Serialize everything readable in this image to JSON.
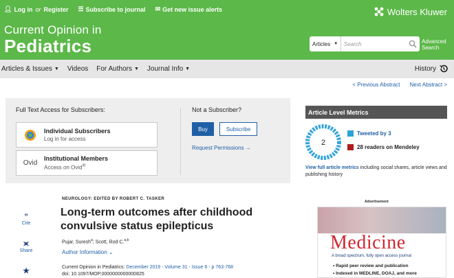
{
  "header": {
    "login_label": "Log in",
    "or_text": "or",
    "register_label": "Register",
    "subscribe_label": "Subscribe to journal",
    "alerts_label": "Get new issue alerts",
    "brand": "Wolters Kluwer",
    "journal_prefix": "Current Opinion in",
    "journal_name": "Pediatrics",
    "search": {
      "scope_selected": "Articles",
      "placeholder": "Search",
      "advanced_line1": "Advanced",
      "advanced_line2": "Search"
    }
  },
  "nav": {
    "items": [
      "Articles & Issues",
      "Videos",
      "For Authors",
      "Journal Info"
    ],
    "history_label": "History"
  },
  "pager": {
    "prev_label": "< Previous Abstract",
    "next_label": "Next Abstract >"
  },
  "access": {
    "title": "Full Text Access for Subscribers:",
    "individual_title": "Individual Subscribers",
    "individual_sub": "Log in for access",
    "institutional_title": "Institutional Members",
    "institutional_sub": "Access on Ovid",
    "ovid_logo": "Ovid",
    "not_subscriber": "Not a Subscriber?",
    "buy_label": "Buy",
    "subscribe_label": "Subscribe",
    "request_permissions": "Request Permissions →"
  },
  "metrics": {
    "title": "Article Level Metrics",
    "altmetric_score": "2",
    "tweeted": "Tweeted by 3",
    "mendeley": "28 readers on Mendeley",
    "view_link": "View full article metrics",
    "view_rest": " including social shares, article views and publishing history",
    "colors": {
      "twitter": "#2aa3d6",
      "mendeley": "#b01c1c",
      "altmetric_ring": "#35a4d9"
    }
  },
  "rail": {
    "cite_label": "Cite",
    "share_label": "Share"
  },
  "article": {
    "section": "NEUROLOGY: EDITED BY ROBERT C. TASKER",
    "title": "Long-term outcomes after childhood convulsive status epilepticus",
    "author1": "Pujar, Suresh",
    "author1_sup": "a",
    "author2": "; Scott, Rod C.",
    "author2_sup": "a,b",
    "author_info": "Author Information",
    "journal_label": "Current Opinion in Pediatrics: ",
    "citation": "December 2019 - Volume 31 - Issue 6 - p 763-768",
    "doi": "doi: 10.1097/MOP.0000000000000825"
  },
  "ad": {
    "label": "Advertisement",
    "brand": "Medicine",
    "tagline": "A broad spectrum, fully open access journal",
    "bullet1": "Rapid peer review and publication",
    "bullet2": "Indexed in MEDLINE, DOAJ, and more"
  }
}
